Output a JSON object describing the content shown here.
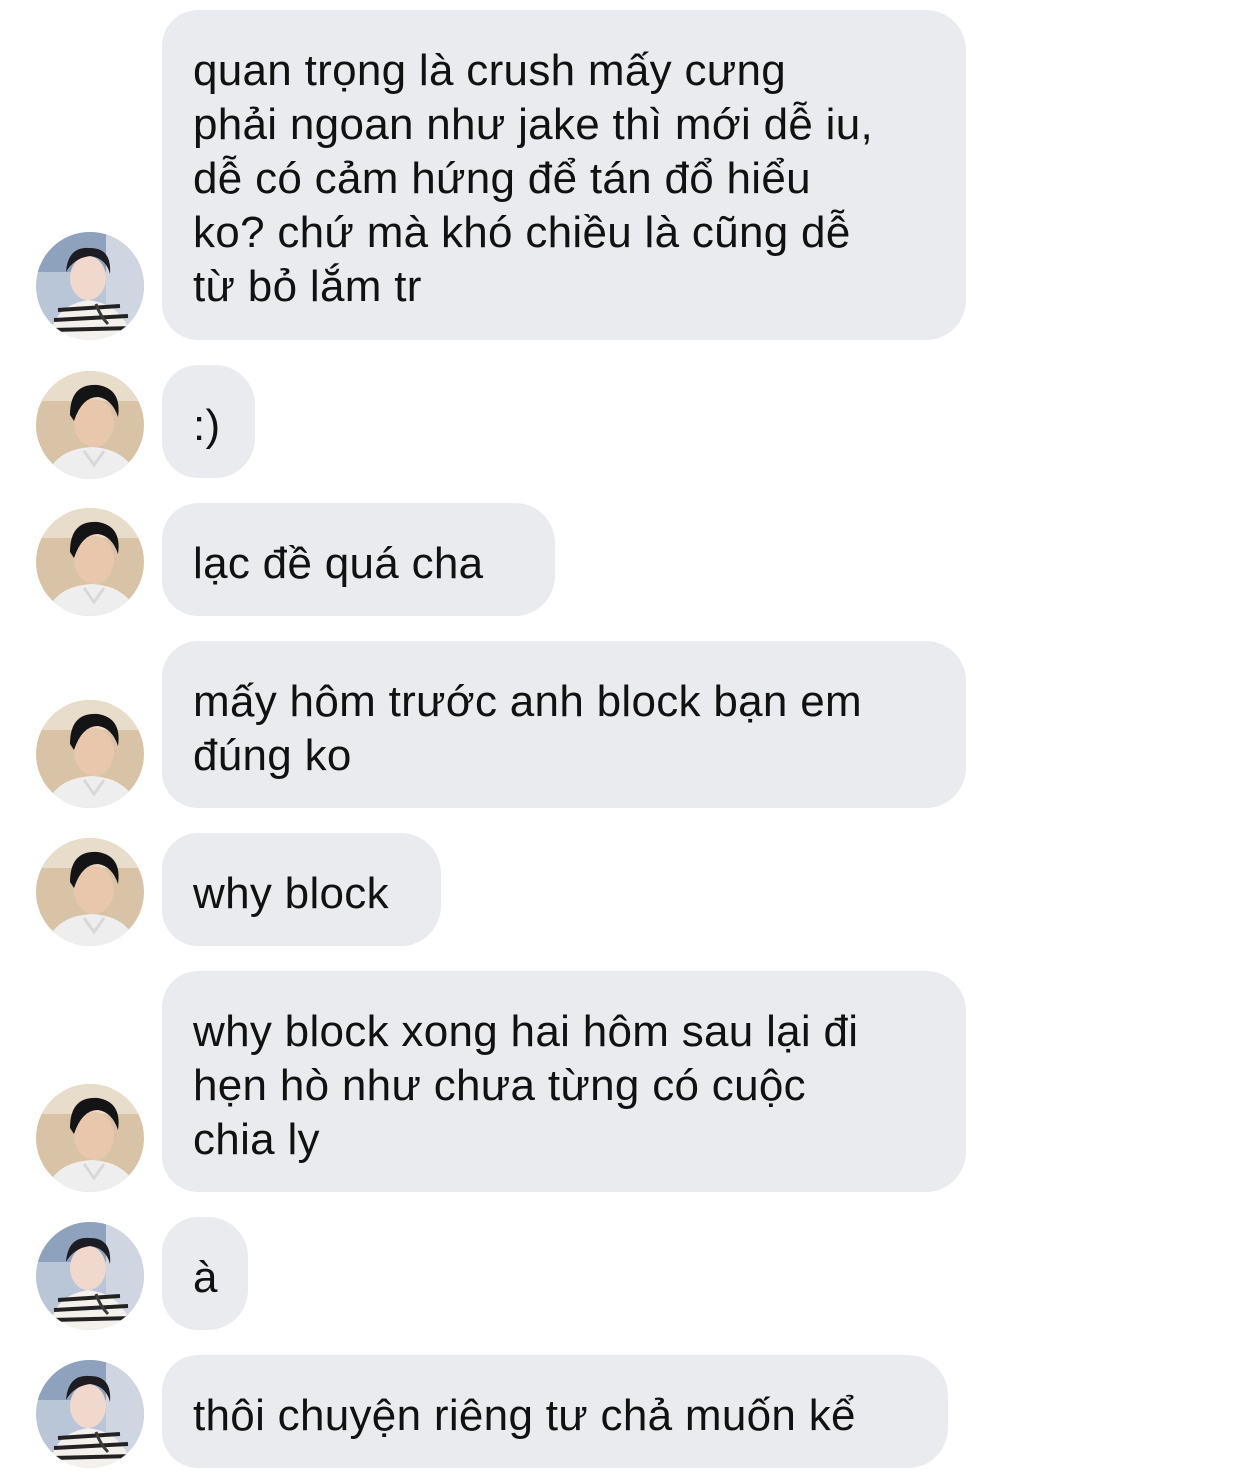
{
  "conversation": {
    "messages": [
      {
        "sender": "a",
        "text": "quan trọng là crush mấy cưng\nphải ngoan như jake thì mới dễ iu,\ndễ có cảm hứng để tán đổ hiểu\nko? chứ mà khó chiều là cũng dễ\ntừ bỏ lắm tr"
      },
      {
        "sender": "b",
        "text": ":)"
      },
      {
        "sender": "b",
        "text": "lạc đề quá cha"
      },
      {
        "sender": "b",
        "text": "mấy hôm trước anh block bạn em\nđúng ko"
      },
      {
        "sender": "b",
        "text": "why block"
      },
      {
        "sender": "b",
        "text": "why block xong hai hôm sau lại đi\nhẹn hò như chưa từng có cuộc\nchia ly"
      },
      {
        "sender": "a",
        "text": "à"
      },
      {
        "sender": "a",
        "text": "thôi chuyện riêng tư chả muốn kể"
      }
    ]
  },
  "avatars": {
    "a": "avatar-striped-shirt",
    "b": "avatar-beach-selfie"
  },
  "colors": {
    "bubble_bg": "#e9ebef",
    "text": "#111111",
    "background": "#ffffff"
  }
}
